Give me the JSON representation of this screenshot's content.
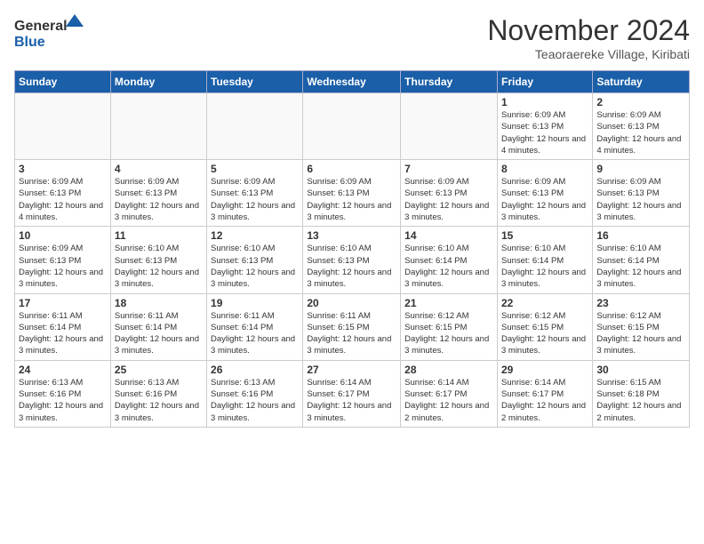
{
  "header": {
    "logo_general": "General",
    "logo_blue": "Blue",
    "month_title": "November 2024",
    "location": "Teaoraereke Village, Kiribati"
  },
  "days_of_week": [
    "Sunday",
    "Monday",
    "Tuesday",
    "Wednesday",
    "Thursday",
    "Friday",
    "Saturday"
  ],
  "weeks": [
    [
      {
        "day": "",
        "info": ""
      },
      {
        "day": "",
        "info": ""
      },
      {
        "day": "",
        "info": ""
      },
      {
        "day": "",
        "info": ""
      },
      {
        "day": "",
        "info": ""
      },
      {
        "day": "1",
        "info": "Sunrise: 6:09 AM\nSunset: 6:13 PM\nDaylight: 12 hours and 4 minutes."
      },
      {
        "day": "2",
        "info": "Sunrise: 6:09 AM\nSunset: 6:13 PM\nDaylight: 12 hours and 4 minutes."
      }
    ],
    [
      {
        "day": "3",
        "info": "Sunrise: 6:09 AM\nSunset: 6:13 PM\nDaylight: 12 hours and 4 minutes."
      },
      {
        "day": "4",
        "info": "Sunrise: 6:09 AM\nSunset: 6:13 PM\nDaylight: 12 hours and 3 minutes."
      },
      {
        "day": "5",
        "info": "Sunrise: 6:09 AM\nSunset: 6:13 PM\nDaylight: 12 hours and 3 minutes."
      },
      {
        "day": "6",
        "info": "Sunrise: 6:09 AM\nSunset: 6:13 PM\nDaylight: 12 hours and 3 minutes."
      },
      {
        "day": "7",
        "info": "Sunrise: 6:09 AM\nSunset: 6:13 PM\nDaylight: 12 hours and 3 minutes."
      },
      {
        "day": "8",
        "info": "Sunrise: 6:09 AM\nSunset: 6:13 PM\nDaylight: 12 hours and 3 minutes."
      },
      {
        "day": "9",
        "info": "Sunrise: 6:09 AM\nSunset: 6:13 PM\nDaylight: 12 hours and 3 minutes."
      }
    ],
    [
      {
        "day": "10",
        "info": "Sunrise: 6:09 AM\nSunset: 6:13 PM\nDaylight: 12 hours and 3 minutes."
      },
      {
        "day": "11",
        "info": "Sunrise: 6:10 AM\nSunset: 6:13 PM\nDaylight: 12 hours and 3 minutes."
      },
      {
        "day": "12",
        "info": "Sunrise: 6:10 AM\nSunset: 6:13 PM\nDaylight: 12 hours and 3 minutes."
      },
      {
        "day": "13",
        "info": "Sunrise: 6:10 AM\nSunset: 6:13 PM\nDaylight: 12 hours and 3 minutes."
      },
      {
        "day": "14",
        "info": "Sunrise: 6:10 AM\nSunset: 6:14 PM\nDaylight: 12 hours and 3 minutes."
      },
      {
        "day": "15",
        "info": "Sunrise: 6:10 AM\nSunset: 6:14 PM\nDaylight: 12 hours and 3 minutes."
      },
      {
        "day": "16",
        "info": "Sunrise: 6:10 AM\nSunset: 6:14 PM\nDaylight: 12 hours and 3 minutes."
      }
    ],
    [
      {
        "day": "17",
        "info": "Sunrise: 6:11 AM\nSunset: 6:14 PM\nDaylight: 12 hours and 3 minutes."
      },
      {
        "day": "18",
        "info": "Sunrise: 6:11 AM\nSunset: 6:14 PM\nDaylight: 12 hours and 3 minutes."
      },
      {
        "day": "19",
        "info": "Sunrise: 6:11 AM\nSunset: 6:14 PM\nDaylight: 12 hours and 3 minutes."
      },
      {
        "day": "20",
        "info": "Sunrise: 6:11 AM\nSunset: 6:15 PM\nDaylight: 12 hours and 3 minutes."
      },
      {
        "day": "21",
        "info": "Sunrise: 6:12 AM\nSunset: 6:15 PM\nDaylight: 12 hours and 3 minutes."
      },
      {
        "day": "22",
        "info": "Sunrise: 6:12 AM\nSunset: 6:15 PM\nDaylight: 12 hours and 3 minutes."
      },
      {
        "day": "23",
        "info": "Sunrise: 6:12 AM\nSunset: 6:15 PM\nDaylight: 12 hours and 3 minutes."
      }
    ],
    [
      {
        "day": "24",
        "info": "Sunrise: 6:13 AM\nSunset: 6:16 PM\nDaylight: 12 hours and 3 minutes."
      },
      {
        "day": "25",
        "info": "Sunrise: 6:13 AM\nSunset: 6:16 PM\nDaylight: 12 hours and 3 minutes."
      },
      {
        "day": "26",
        "info": "Sunrise: 6:13 AM\nSunset: 6:16 PM\nDaylight: 12 hours and 3 minutes."
      },
      {
        "day": "27",
        "info": "Sunrise: 6:14 AM\nSunset: 6:17 PM\nDaylight: 12 hours and 3 minutes."
      },
      {
        "day": "28",
        "info": "Sunrise: 6:14 AM\nSunset: 6:17 PM\nDaylight: 12 hours and 2 minutes."
      },
      {
        "day": "29",
        "info": "Sunrise: 6:14 AM\nSunset: 6:17 PM\nDaylight: 12 hours and 2 minutes."
      },
      {
        "day": "30",
        "info": "Sunrise: 6:15 AM\nSunset: 6:18 PM\nDaylight: 12 hours and 2 minutes."
      }
    ]
  ]
}
